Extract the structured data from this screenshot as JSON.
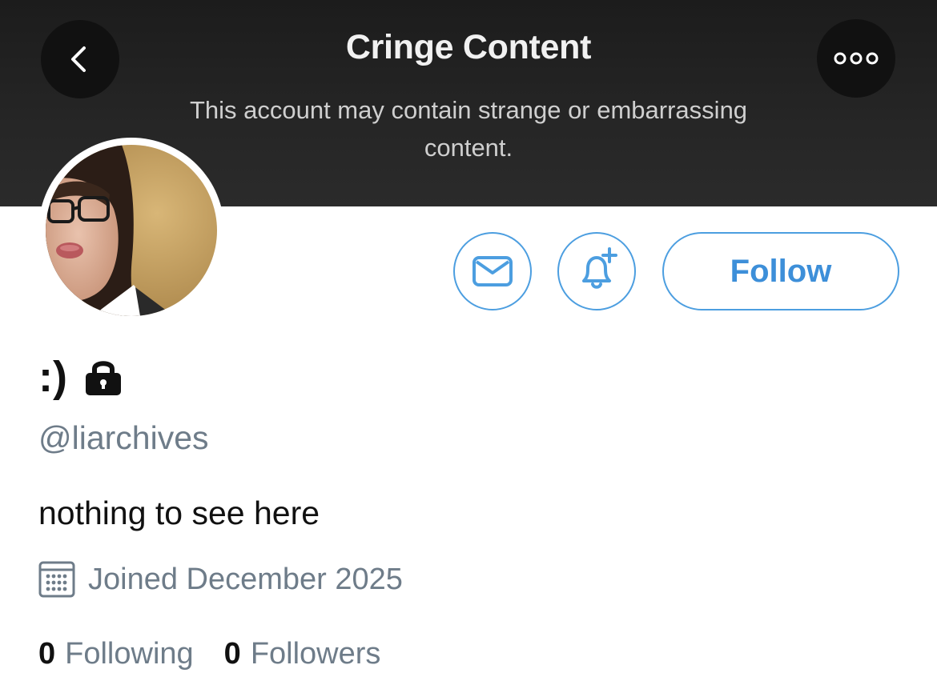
{
  "banner": {
    "title": "Cringe Content",
    "subtitle": "This account may contain strange or embarrassing content.",
    "back_icon": "chevron-left-icon",
    "more_icon": "more-horizontal-icon"
  },
  "profile": {
    "display_name": ":)",
    "protected_icon": "lock-icon",
    "handle": "@liarchives",
    "bio": "nothing to see here",
    "joined": "Joined December 2025",
    "joined_icon": "calendar-icon",
    "following_count": "0",
    "following_label": "Following",
    "followers_count": "0",
    "followers_label": "Followers"
  },
  "actions": {
    "message_icon": "envelope-icon",
    "notify_icon": "bell-plus-icon",
    "follow_label": "Follow"
  },
  "colors": {
    "accent": "#4c9ee0",
    "secondary_text": "#6e7c89",
    "banner_bg": "#252525"
  }
}
